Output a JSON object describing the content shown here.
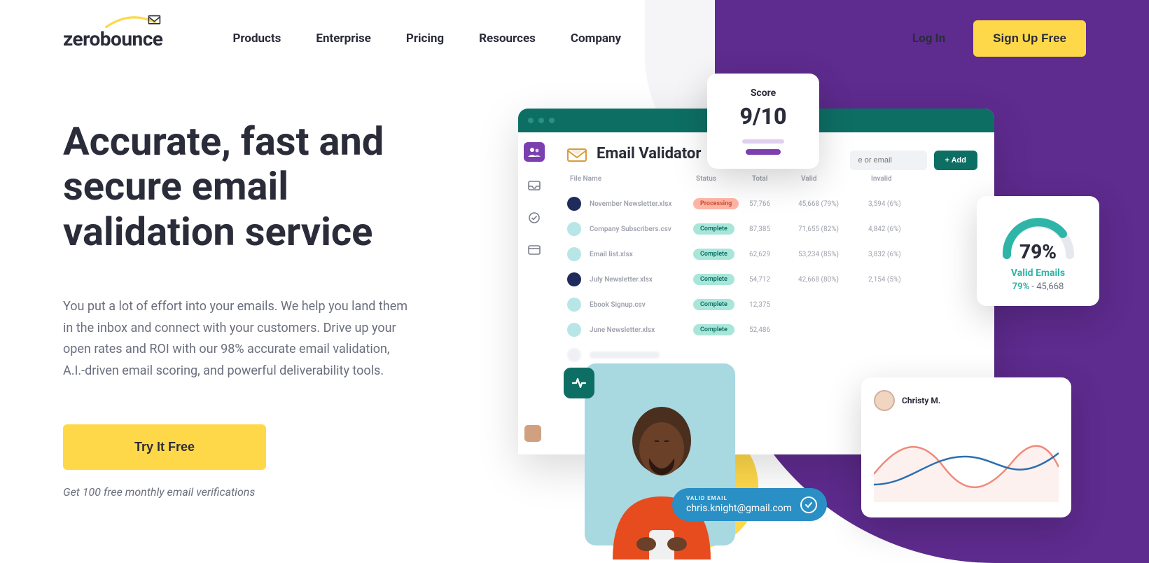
{
  "brand": {
    "name": "zerobounce"
  },
  "nav": {
    "items": [
      "Products",
      "Enterprise",
      "Pricing",
      "Resources",
      "Company"
    ],
    "login": "Log In",
    "signup": "Sign Up Free"
  },
  "hero": {
    "headline": "Accurate, fast and secure email validation service",
    "body": "You put a lot of effort into your emails. We help you land them in the inbox and connect with your customers. Drive up your open rates and ROI with our 98% accurate email validation, A.I.-driven email scoring, and powerful deliverability tools.",
    "cta": "Try It Free",
    "subtext": "Get 100 free monthly email verifications"
  },
  "mockup": {
    "title": "Email Validator",
    "search_placeholder": "e or email",
    "add_button": "+ Add",
    "columns": [
      "File Name",
      "Status",
      "Total",
      "Valid",
      "Invalid"
    ],
    "rows": [
      {
        "dot": "dark",
        "file": "November Newsletter.xlsx",
        "status": "Processing",
        "total": "57,766",
        "valid": "45,668 (79%)",
        "invalid": "3,594 (6%)"
      },
      {
        "dot": "light",
        "file": "Company Subscribers.csv",
        "status": "Complete",
        "total": "87,385",
        "valid": "71,655 (82%)",
        "invalid": "4,842 (6%)"
      },
      {
        "dot": "light",
        "file": "Email list.xlsx",
        "status": "Complete",
        "total": "62,629",
        "valid": "53,234 (85%)",
        "invalid": "3,832 (6%)"
      },
      {
        "dot": "dark",
        "file": "July Newsletter.xlsx",
        "status": "Complete",
        "total": "54,712",
        "valid": "42,668 (80%)",
        "invalid": "2,154 (5%)"
      },
      {
        "dot": "light",
        "file": "Ebook Signup.csv",
        "status": "Complete",
        "total": "12,375",
        "valid": "",
        "invalid": ""
      },
      {
        "dot": "light",
        "file": "June Newsletter.xlsx",
        "status": "Complete",
        "total": "52,486",
        "valid": "",
        "invalid": ""
      }
    ]
  },
  "score": {
    "label": "Score",
    "value": "9/10"
  },
  "gauge": {
    "pct": "79%",
    "title": "Valid Emails",
    "pct2": "79%",
    "count": "- 45,668"
  },
  "chart_user": {
    "name": "Christy M."
  },
  "email_pill": {
    "label": "VALID EMAIL",
    "email": "chris.knight@gmail.com"
  }
}
